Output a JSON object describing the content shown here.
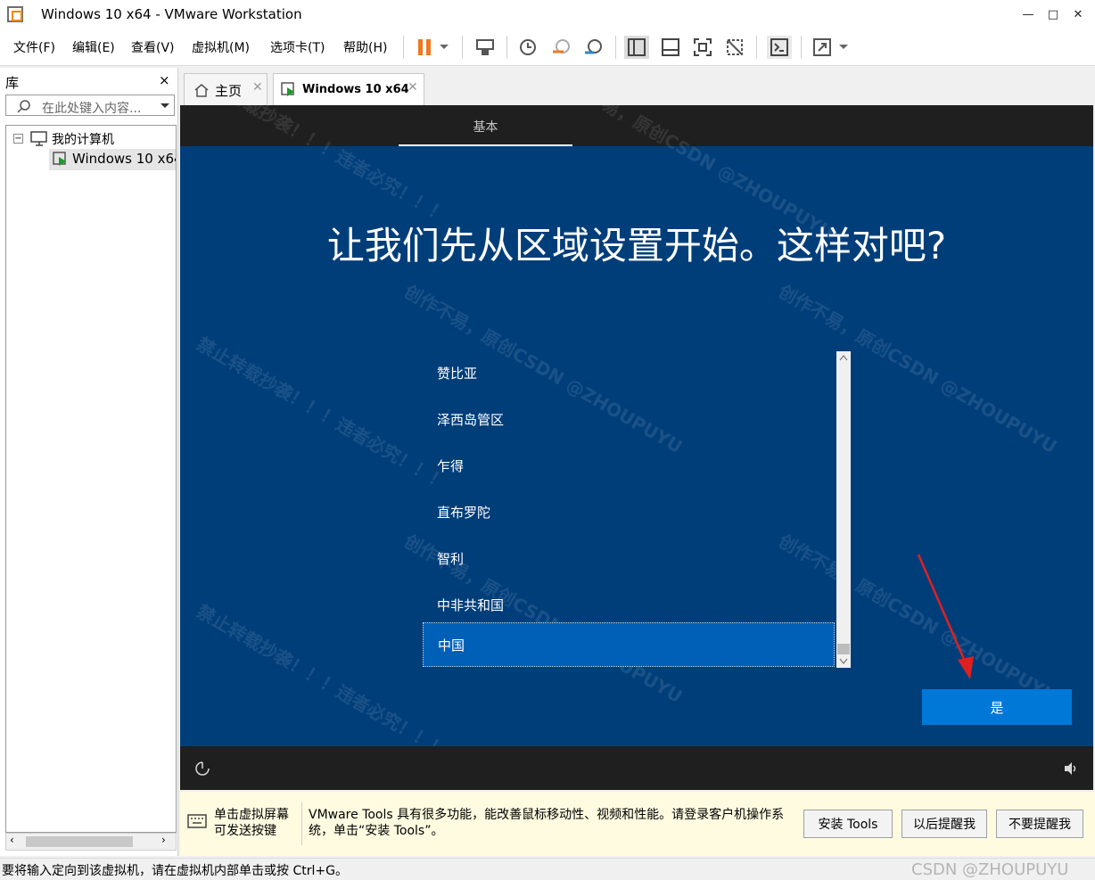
{
  "window": {
    "title": "Windows 10 x64 - VMware Workstation",
    "minimize": "—",
    "maximize": "□",
    "close": "✕"
  },
  "menu": [
    "文件(F)",
    "编辑(E)",
    "查看(V)",
    "虚拟机(M)",
    "选项卡(T)",
    "帮助(H)"
  ],
  "library": {
    "title": "库",
    "close": "×",
    "search_placeholder": "在此处键入内容...",
    "tree": {
      "root": "我的计算机",
      "child": "Windows 10 x64"
    }
  },
  "tabs": [
    {
      "label": "主页",
      "icon": "home-icon"
    },
    {
      "label": "Windows 10 x64",
      "icon": "vm-icon",
      "active": true
    }
  ],
  "vm": {
    "section_tab": "基本",
    "heading": "让我们先从区域设置开始。这样对吧?",
    "regions": [
      "赞比亚",
      "泽西岛管区",
      "乍得",
      "直布罗陀",
      "智利",
      "中非共和国",
      "中国"
    ],
    "selected_region": "中国",
    "yes_button": "是"
  },
  "notice": {
    "hint": "单击虚拟屏幕可发送按键",
    "message": "VMware Tools 具有很多功能，能改善鼠标移动性、视频和性能。请登录客户机操作系统，单击“安装 Tools”。",
    "buttons": [
      "安装 Tools",
      "以后提醒我",
      "不要提醒我"
    ]
  },
  "status": {
    "text": "要将输入定向到该虚拟机，请在虚拟机内部单击或按 Ctrl+G。",
    "watermark": "CSDN @ZHOUPUYU"
  },
  "watermarks": [
    "创作不易，原创CSDN @ZHOUPUYU",
    "禁止转载抄袭！！！违者必究！！！"
  ],
  "colors": {
    "vm_background": "#003e7a",
    "accent": "#0078d7",
    "selection": "#0060b8",
    "pause": "#f07820"
  }
}
